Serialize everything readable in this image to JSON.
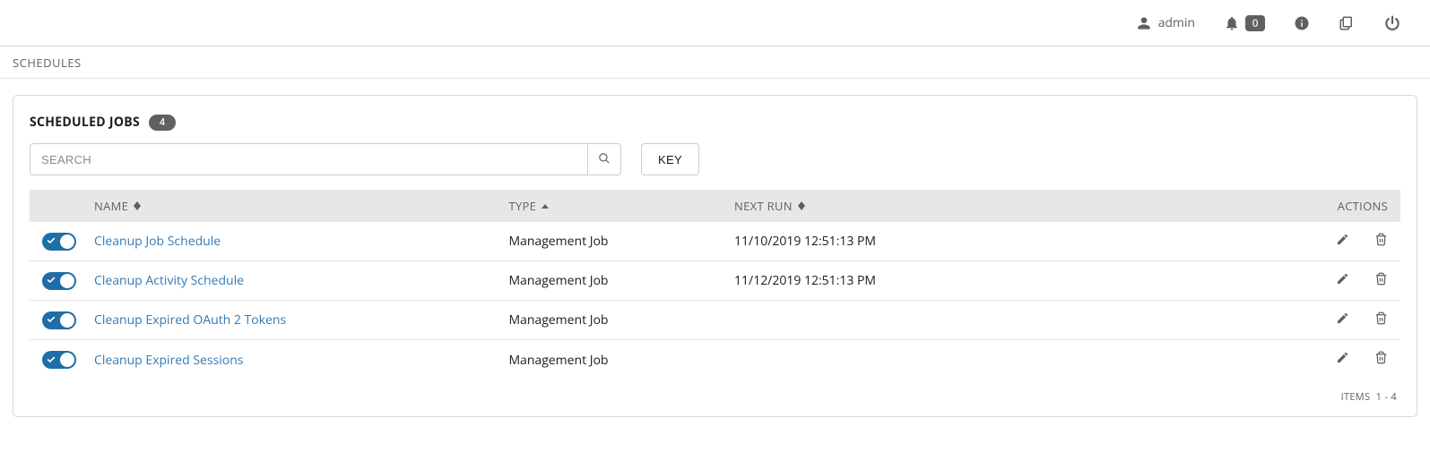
{
  "topbar": {
    "username": "admin",
    "notification_count": "0"
  },
  "breadcrumb": {
    "text": "SCHEDULES"
  },
  "panel": {
    "title": "SCHEDULED JOBS",
    "count": "4"
  },
  "toolbar": {
    "search_placeholder": "SEARCH",
    "key_label": "KEY"
  },
  "columns": {
    "name": "NAME",
    "type": "TYPE",
    "next_run": "NEXT RUN",
    "actions": "ACTIONS"
  },
  "rows": [
    {
      "name": "Cleanup Job Schedule",
      "type": "Management Job",
      "next_run": "11/10/2019 12:51:13 PM"
    },
    {
      "name": "Cleanup Activity Schedule",
      "type": "Management Job",
      "next_run": "11/12/2019 12:51:13 PM"
    },
    {
      "name": "Cleanup Expired OAuth 2 Tokens",
      "type": "Management Job",
      "next_run": ""
    },
    {
      "name": "Cleanup Expired Sessions",
      "type": "Management Job",
      "next_run": ""
    }
  ],
  "footer": {
    "items_label": "ITEMS",
    "items_range": "1 - 4"
  }
}
